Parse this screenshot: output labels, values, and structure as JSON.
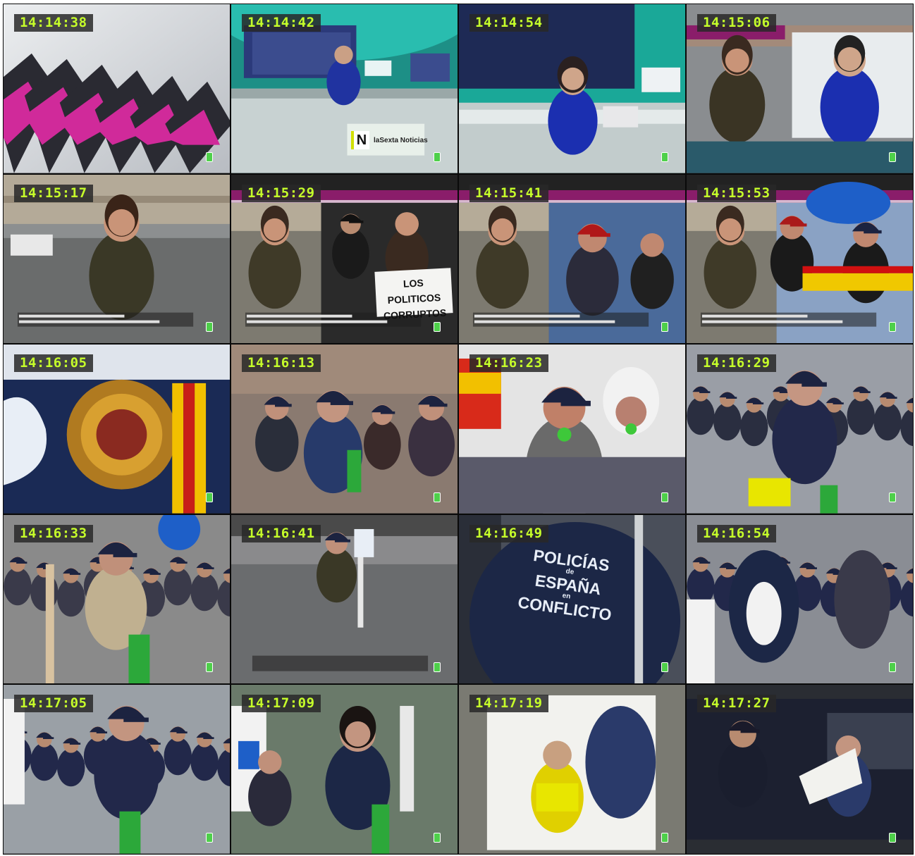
{
  "frames": [
    {
      "time": "14:14:38",
      "scene": "abstract-pink-bars"
    },
    {
      "time": "14:14:42",
      "scene": "news-studio-wide"
    },
    {
      "time": "14:14:54",
      "scene": "news-studio-anchor"
    },
    {
      "time": "14:15:06",
      "scene": "split-reporter-anchor"
    },
    {
      "time": "14:15:17",
      "scene": "reporter-street"
    },
    {
      "time": "14:15:29",
      "scene": "split-reporter-placard"
    },
    {
      "time": "14:15:41",
      "scene": "split-reporter-crowd"
    },
    {
      "time": "14:15:53",
      "scene": "split-reporter-flag"
    },
    {
      "time": "14:16:05",
      "scene": "police-badge"
    },
    {
      "time": "14:16:13",
      "scene": "crowd-interview"
    },
    {
      "time": "14:16:23",
      "scene": "whistle-closeup"
    },
    {
      "time": "14:16:29",
      "scene": "marcher-interview"
    },
    {
      "time": "14:16:33",
      "scene": "flag-holder-interview"
    },
    {
      "time": "14:16:41",
      "scene": "lone-marcher"
    },
    {
      "time": "14:16:49",
      "scene": "tshirt-closeup"
    },
    {
      "time": "14:16:54",
      "scene": "march-backs"
    },
    {
      "time": "14:17:05",
      "scene": "crowd-interview-2"
    },
    {
      "time": "14:17:09",
      "scene": "reporter-crowd"
    },
    {
      "time": "14:17:19",
      "scene": "banner-doll"
    },
    {
      "time": "14:17:27",
      "scene": "police-van"
    }
  ],
  "overlays": {
    "placard_text": "LOS POLITICOS CORRUPTOS",
    "shirt_line1": "POLICÍAS",
    "shirt_line2": "de",
    "shirt_line3": "ESPAÑA",
    "shirt_line4": "en",
    "shirt_line5": "CONFLICTO",
    "brand_letter": "N",
    "brand_name": "laSexta Noticias"
  },
  "colors": {
    "timestamp": "#c6ff2a",
    "channel_logo": "#4ed04a",
    "magenta_band": "#8a1d6a"
  }
}
